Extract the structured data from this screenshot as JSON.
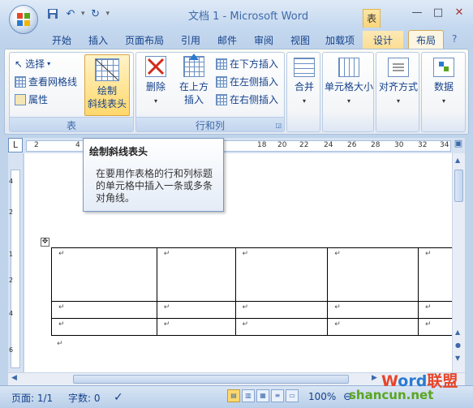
{
  "window": {
    "title": "文档 1 - Microsoft Word",
    "context_tab_label": "表",
    "controls": [
      "—",
      "□",
      "✕"
    ]
  },
  "quick_access": [
    "save-icon",
    "undo-icon",
    "redo-icon",
    "customize-icon"
  ],
  "tabs": [
    {
      "label": "开始"
    },
    {
      "label": "插入"
    },
    {
      "label": "页面布局"
    },
    {
      "label": "引用"
    },
    {
      "label": "邮件"
    },
    {
      "label": "审阅"
    },
    {
      "label": "视图"
    },
    {
      "label": "加载项"
    },
    {
      "label": "设计"
    },
    {
      "label": "布局",
      "active": true
    }
  ],
  "ribbon": {
    "table_group": {
      "label": "表",
      "select": "选择",
      "view_gridlines": "查看网格线",
      "properties": "属性",
      "draw_diagonal_line1": "绘制",
      "draw_diagonal_line2": "斜线表头"
    },
    "rows_cols_group": {
      "label": "行和列",
      "delete": "删除",
      "insert_above_line1": "在上方",
      "insert_above_line2": "插入",
      "insert_below": "在下方插入",
      "insert_left": "在左侧插入",
      "insert_right": "在右侧插入"
    },
    "merge": "合并",
    "cell_size": "单元格大小",
    "alignment": "对齐方式",
    "data": "数据"
  },
  "ruler": {
    "ticks": [
      "2",
      "4",
      "18",
      "20",
      "22",
      "24",
      "26",
      "28",
      "30",
      "32",
      "34"
    ],
    "vticks": [
      "4",
      "2",
      "1",
      "2",
      "4",
      "6"
    ]
  },
  "tooltip": {
    "title": "绘制斜线表头",
    "body": "在要用作表格的行和列标题的单元格中插入一条或多条对角线。"
  },
  "document": {
    "cell_mark": "↵",
    "rows": 3,
    "cols": 5
  },
  "status": {
    "page": "页面: 1/1",
    "words": "字数: 0",
    "zoom": "100%"
  },
  "watermark": {
    "part1": "W",
    "part2": "ord",
    "part3": "联盟",
    "site": "shancun.net"
  }
}
